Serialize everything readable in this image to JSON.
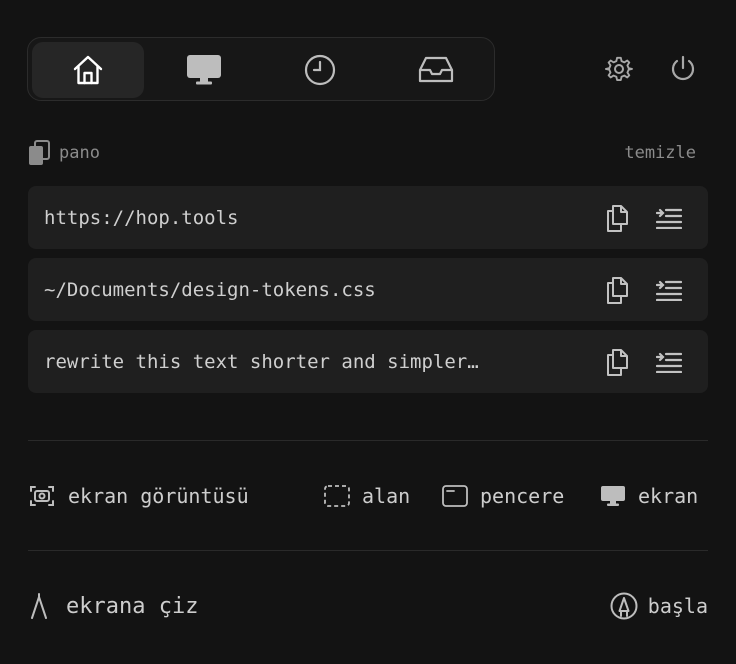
{
  "tabs": [
    {
      "icon": "home-icon",
      "active": true
    },
    {
      "icon": "monitor-icon",
      "active": false
    },
    {
      "icon": "clock-icon",
      "active": false
    },
    {
      "icon": "inbox-icon",
      "active": false
    }
  ],
  "top_actions": [
    {
      "icon": "gear-icon"
    },
    {
      "icon": "power-icon"
    }
  ],
  "clipboard": {
    "title": "pano",
    "clear_label": "temizle",
    "items": [
      {
        "text": "https://hop.tools"
      },
      {
        "text": "~/Documents/design-tokens.css"
      },
      {
        "text": "rewrite this text shorter and simpler…"
      }
    ]
  },
  "screenshot": {
    "label": "ekran görüntüsü",
    "options": [
      {
        "label": "alan",
        "icon": "area-select-icon"
      },
      {
        "label": "pencere",
        "icon": "window-icon"
      },
      {
        "label": "ekran",
        "icon": "monitor-icon"
      }
    ]
  },
  "draw": {
    "label": "ekrana çiz",
    "start_label": "başla"
  },
  "colors": {
    "background": "#131313",
    "row": "#1f1f1f",
    "active_tab": "#262626",
    "text": "#cdcdcd",
    "muted": "#8b8b8b"
  }
}
